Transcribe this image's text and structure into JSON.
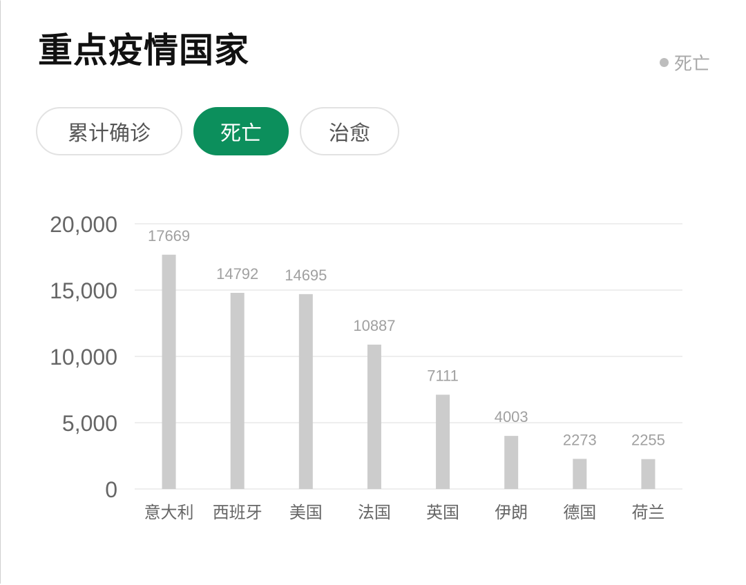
{
  "header": {
    "title": "重点疫情国家",
    "legend_label": "死亡"
  },
  "tabs": [
    {
      "label": "累计确诊",
      "active": false
    },
    {
      "label": "死亡",
      "active": true
    },
    {
      "label": "治愈",
      "active": false
    }
  ],
  "colors": {
    "accent": "#0c8f5c",
    "bar": "#cccccc",
    "value_label": "#a0a0a0",
    "axis_label": "#666666",
    "grid": "#eeeeee"
  },
  "chart_data": {
    "type": "bar",
    "categories": [
      "意大利",
      "西班牙",
      "美国",
      "法国",
      "英国",
      "伊朗",
      "德国",
      "荷兰"
    ],
    "values": [
      17669,
      14792,
      14695,
      10887,
      7111,
      4003,
      2273,
      2255
    ],
    "value_labels": [
      "17669",
      "14792",
      "14695",
      "10887",
      "7111",
      "4003",
      "2273",
      "2255"
    ],
    "y_ticks": [
      0,
      5000,
      10000,
      15000,
      20000
    ],
    "y_tick_labels": [
      "0",
      "5,000",
      "10,000",
      "15,000",
      "20,000"
    ],
    "ylim": [
      0,
      20000
    ],
    "grid": true,
    "legend": "top-right"
  }
}
